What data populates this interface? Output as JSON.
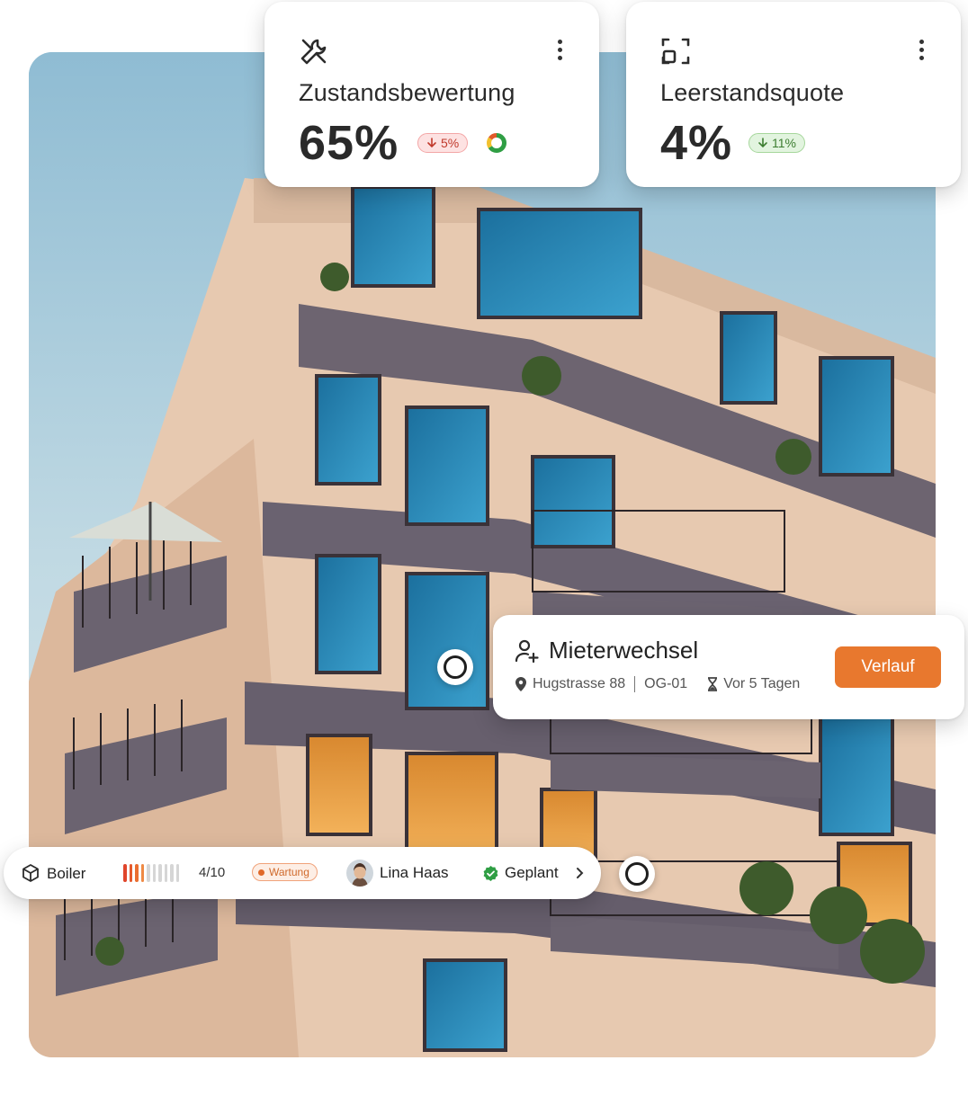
{
  "kpis": [
    {
      "label": "Zustandsbewertung",
      "value": "65%",
      "delta": "5%",
      "delta_direction": "down",
      "delta_tone": "negative",
      "icon": "tools-icon",
      "has_donut": true
    },
    {
      "label": "Leerstandsquote",
      "value": "4%",
      "delta": "11%",
      "delta_direction": "down",
      "delta_tone": "positive",
      "icon": "vacancy-icon",
      "has_donut": false
    }
  ],
  "event": {
    "title": "Mieterwechsel",
    "icon": "person-add-icon",
    "address": "Hugstrasse 88",
    "unit": "OG-01",
    "time": "Vor 5 Tagen",
    "button_label": "Verlauf"
  },
  "task": {
    "name": "Boiler",
    "icon": "cube-icon",
    "score": "4/10",
    "score_value": 4,
    "score_max": 10,
    "tag": "Wartung",
    "assignee": "Lina Haas",
    "status": "Geplant"
  },
  "colors": {
    "accent": "#e8782e",
    "negative": "#c0392b",
    "positive": "#3c7d30",
    "status_ok": "#2f9e44"
  }
}
